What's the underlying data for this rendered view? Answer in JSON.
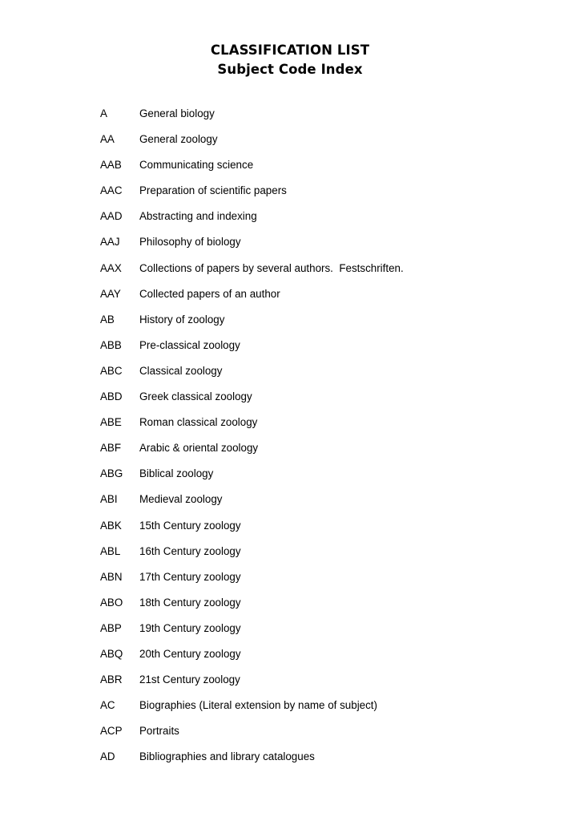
{
  "document": {
    "title_line_1": "CLASSIFICATION LIST",
    "title_line_2": "Subject Code Index"
  },
  "entries": [
    {
      "code": "A",
      "description": "General biology"
    },
    {
      "code": "AA",
      "description": "General zoology"
    },
    {
      "code": "AAB",
      "description": "Communicating science"
    },
    {
      "code": "AAC",
      "description": "Preparation of scientific papers"
    },
    {
      "code": "AAD",
      "description": "Abstracting and indexing"
    },
    {
      "code": "AAJ",
      "description": "Philosophy of biology"
    },
    {
      "code": "AAX",
      "description": "Collections of papers by several authors.  Festschriften."
    },
    {
      "code": "AAY",
      "description": "Collected papers of an author"
    },
    {
      "code": "AB",
      "description": "History of zoology"
    },
    {
      "code": "ABB",
      "description": "Pre-classical zoology"
    },
    {
      "code": "ABC",
      "description": "Classical zoology"
    },
    {
      "code": "ABD",
      "description": "Greek classical zoology"
    },
    {
      "code": "ABE",
      "description": "Roman classical zoology"
    },
    {
      "code": "ABF",
      "description": "Arabic & oriental zoology"
    },
    {
      "code": "ABG",
      "description": "Biblical zoology"
    },
    {
      "code": "ABI",
      "description": "Medieval zoology"
    },
    {
      "code": "ABK",
      "description": "15th Century zoology"
    },
    {
      "code": "ABL",
      "description": "16th Century zoology"
    },
    {
      "code": "ABN",
      "description": "17th Century zoology"
    },
    {
      "code": "ABO",
      "description": "18th Century zoology"
    },
    {
      "code": "ABP",
      "description": "19th Century zoology"
    },
    {
      "code": "ABQ",
      "description": "20th Century zoology"
    },
    {
      "code": "ABR",
      "description": "21st Century zoology"
    },
    {
      "code": "AC",
      "description": "Biographies (Literal extension by name of subject)"
    },
    {
      "code": "ACP",
      "description": "Portraits"
    },
    {
      "code": "AD",
      "description": "Bibliographies and library catalogues"
    }
  ]
}
